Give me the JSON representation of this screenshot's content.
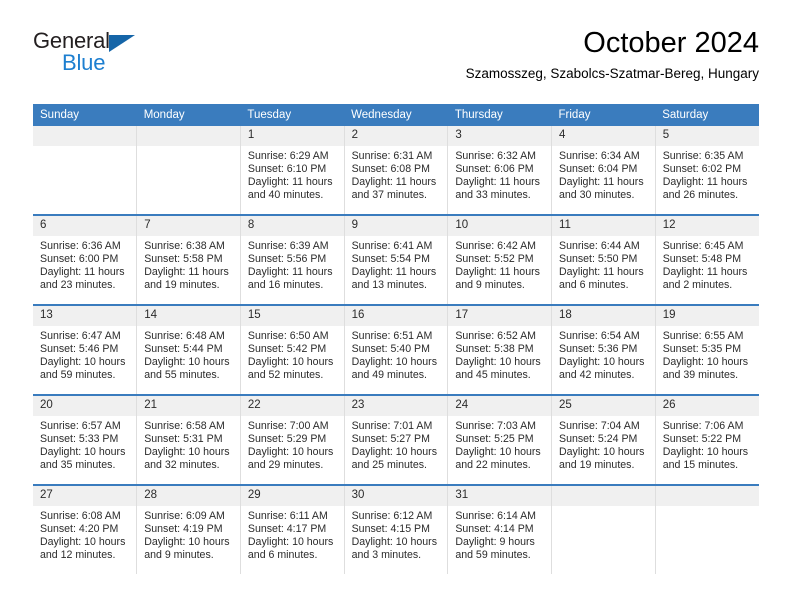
{
  "brand": {
    "name_top": "General",
    "name_bottom": "Blue",
    "accent_color": "#1d7fd0",
    "triangle_color": "#1565a8"
  },
  "header": {
    "title": "October 2024",
    "subtitle": "Szamosszeg, Szabolcs-Szatmar-Bereg, Hungary"
  },
  "calendar": {
    "header_bg": "#3a7cbe",
    "daynum_bg": "#f0f0f0",
    "weekday_headers": [
      "Sunday",
      "Monday",
      "Tuesday",
      "Wednesday",
      "Thursday",
      "Friday",
      "Saturday"
    ],
    "weeks": [
      [
        {
          "day": "",
          "sunrise": "",
          "sunset": "",
          "daylight": ""
        },
        {
          "day": "",
          "sunrise": "",
          "sunset": "",
          "daylight": ""
        },
        {
          "day": "1",
          "sunrise": "Sunrise: 6:29 AM",
          "sunset": "Sunset: 6:10 PM",
          "daylight": "Daylight: 11 hours and 40 minutes."
        },
        {
          "day": "2",
          "sunrise": "Sunrise: 6:31 AM",
          "sunset": "Sunset: 6:08 PM",
          "daylight": "Daylight: 11 hours and 37 minutes."
        },
        {
          "day": "3",
          "sunrise": "Sunrise: 6:32 AM",
          "sunset": "Sunset: 6:06 PM",
          "daylight": "Daylight: 11 hours and 33 minutes."
        },
        {
          "day": "4",
          "sunrise": "Sunrise: 6:34 AM",
          "sunset": "Sunset: 6:04 PM",
          "daylight": "Daylight: 11 hours and 30 minutes."
        },
        {
          "day": "5",
          "sunrise": "Sunrise: 6:35 AM",
          "sunset": "Sunset: 6:02 PM",
          "daylight": "Daylight: 11 hours and 26 minutes."
        }
      ],
      [
        {
          "day": "6",
          "sunrise": "Sunrise: 6:36 AM",
          "sunset": "Sunset: 6:00 PM",
          "daylight": "Daylight: 11 hours and 23 minutes."
        },
        {
          "day": "7",
          "sunrise": "Sunrise: 6:38 AM",
          "sunset": "Sunset: 5:58 PM",
          "daylight": "Daylight: 11 hours and 19 minutes."
        },
        {
          "day": "8",
          "sunrise": "Sunrise: 6:39 AM",
          "sunset": "Sunset: 5:56 PM",
          "daylight": "Daylight: 11 hours and 16 minutes."
        },
        {
          "day": "9",
          "sunrise": "Sunrise: 6:41 AM",
          "sunset": "Sunset: 5:54 PM",
          "daylight": "Daylight: 11 hours and 13 minutes."
        },
        {
          "day": "10",
          "sunrise": "Sunrise: 6:42 AM",
          "sunset": "Sunset: 5:52 PM",
          "daylight": "Daylight: 11 hours and 9 minutes."
        },
        {
          "day": "11",
          "sunrise": "Sunrise: 6:44 AM",
          "sunset": "Sunset: 5:50 PM",
          "daylight": "Daylight: 11 hours and 6 minutes."
        },
        {
          "day": "12",
          "sunrise": "Sunrise: 6:45 AM",
          "sunset": "Sunset: 5:48 PM",
          "daylight": "Daylight: 11 hours and 2 minutes."
        }
      ],
      [
        {
          "day": "13",
          "sunrise": "Sunrise: 6:47 AM",
          "sunset": "Sunset: 5:46 PM",
          "daylight": "Daylight: 10 hours and 59 minutes."
        },
        {
          "day": "14",
          "sunrise": "Sunrise: 6:48 AM",
          "sunset": "Sunset: 5:44 PM",
          "daylight": "Daylight: 10 hours and 55 minutes."
        },
        {
          "day": "15",
          "sunrise": "Sunrise: 6:50 AM",
          "sunset": "Sunset: 5:42 PM",
          "daylight": "Daylight: 10 hours and 52 minutes."
        },
        {
          "day": "16",
          "sunrise": "Sunrise: 6:51 AM",
          "sunset": "Sunset: 5:40 PM",
          "daylight": "Daylight: 10 hours and 49 minutes."
        },
        {
          "day": "17",
          "sunrise": "Sunrise: 6:52 AM",
          "sunset": "Sunset: 5:38 PM",
          "daylight": "Daylight: 10 hours and 45 minutes."
        },
        {
          "day": "18",
          "sunrise": "Sunrise: 6:54 AM",
          "sunset": "Sunset: 5:36 PM",
          "daylight": "Daylight: 10 hours and 42 minutes."
        },
        {
          "day": "19",
          "sunrise": "Sunrise: 6:55 AM",
          "sunset": "Sunset: 5:35 PM",
          "daylight": "Daylight: 10 hours and 39 minutes."
        }
      ],
      [
        {
          "day": "20",
          "sunrise": "Sunrise: 6:57 AM",
          "sunset": "Sunset: 5:33 PM",
          "daylight": "Daylight: 10 hours and 35 minutes."
        },
        {
          "day": "21",
          "sunrise": "Sunrise: 6:58 AM",
          "sunset": "Sunset: 5:31 PM",
          "daylight": "Daylight: 10 hours and 32 minutes."
        },
        {
          "day": "22",
          "sunrise": "Sunrise: 7:00 AM",
          "sunset": "Sunset: 5:29 PM",
          "daylight": "Daylight: 10 hours and 29 minutes."
        },
        {
          "day": "23",
          "sunrise": "Sunrise: 7:01 AM",
          "sunset": "Sunset: 5:27 PM",
          "daylight": "Daylight: 10 hours and 25 minutes."
        },
        {
          "day": "24",
          "sunrise": "Sunrise: 7:03 AM",
          "sunset": "Sunset: 5:25 PM",
          "daylight": "Daylight: 10 hours and 22 minutes."
        },
        {
          "day": "25",
          "sunrise": "Sunrise: 7:04 AM",
          "sunset": "Sunset: 5:24 PM",
          "daylight": "Daylight: 10 hours and 19 minutes."
        },
        {
          "day": "26",
          "sunrise": "Sunrise: 7:06 AM",
          "sunset": "Sunset: 5:22 PM",
          "daylight": "Daylight: 10 hours and 15 minutes."
        }
      ],
      [
        {
          "day": "27",
          "sunrise": "Sunrise: 6:08 AM",
          "sunset": "Sunset: 4:20 PM",
          "daylight": "Daylight: 10 hours and 12 minutes."
        },
        {
          "day": "28",
          "sunrise": "Sunrise: 6:09 AM",
          "sunset": "Sunset: 4:19 PM",
          "daylight": "Daylight: 10 hours and 9 minutes."
        },
        {
          "day": "29",
          "sunrise": "Sunrise: 6:11 AM",
          "sunset": "Sunset: 4:17 PM",
          "daylight": "Daylight: 10 hours and 6 minutes."
        },
        {
          "day": "30",
          "sunrise": "Sunrise: 6:12 AM",
          "sunset": "Sunset: 4:15 PM",
          "daylight": "Daylight: 10 hours and 3 minutes."
        },
        {
          "day": "31",
          "sunrise": "Sunrise: 6:14 AM",
          "sunset": "Sunset: 4:14 PM",
          "daylight": "Daylight: 9 hours and 59 minutes."
        },
        {
          "day": "",
          "sunrise": "",
          "sunset": "",
          "daylight": ""
        },
        {
          "day": "",
          "sunrise": "",
          "sunset": "",
          "daylight": ""
        }
      ]
    ]
  }
}
